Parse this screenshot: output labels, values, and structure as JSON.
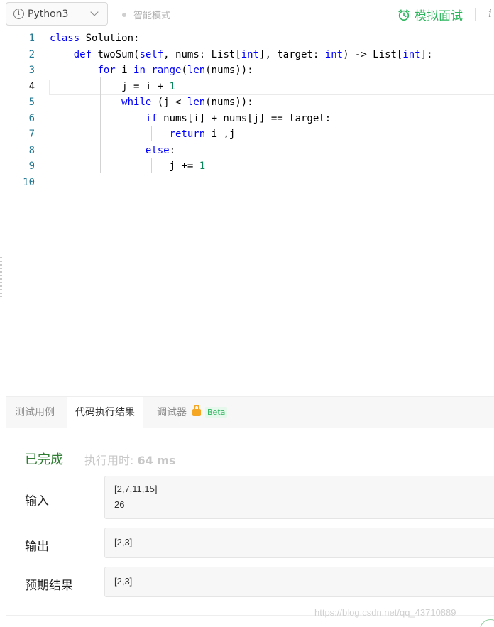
{
  "toolbar": {
    "language": "Python3",
    "smart_mode": "智能模式",
    "mock_interview": "模拟面试",
    "info_glyph": "i"
  },
  "editor": {
    "line_numbers": [
      "1",
      "2",
      "3",
      "4",
      "5",
      "6",
      "7",
      "8",
      "9",
      "10"
    ],
    "active_line": 4
  },
  "tabs": {
    "test_cases": "测试用例",
    "code_result": "代码执行结果",
    "debugger": "调试器",
    "beta": "Beta"
  },
  "result": {
    "status": "已完成",
    "runtime_label": "执行用时:",
    "runtime_value": "64 ms",
    "input_label": "输入",
    "input_line1": "[2,7,11,15]",
    "input_line2": "26",
    "output_label": "输出",
    "output_value": "[2,3]",
    "expected_label": "预期结果",
    "expected_value": "[2,3]"
  },
  "watermark": "https://blog.csdn.net/qq_43710889",
  "colors": {
    "accent_green": "#2db55d",
    "status_green": "#2e7d32",
    "keyword_blue": "#0000ff",
    "number_green": "#09885a",
    "line_number": "#237893",
    "lock_orange": "#f5a623"
  }
}
